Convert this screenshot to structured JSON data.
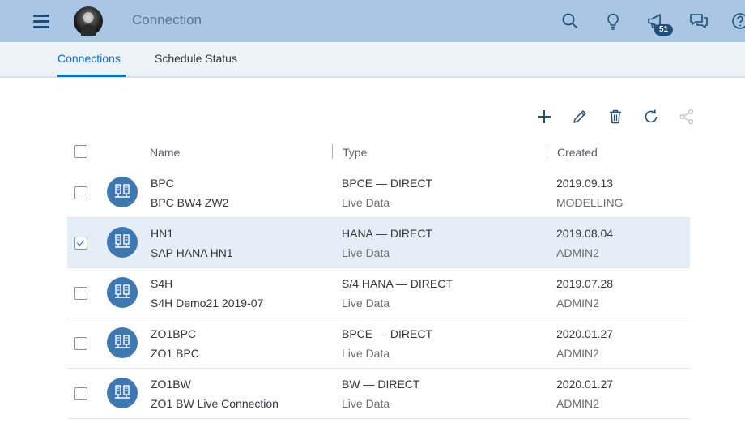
{
  "shell": {
    "title": "Connection",
    "notification_count": "51"
  },
  "tabs": [
    {
      "label": "Connections",
      "active": true
    },
    {
      "label": "Schedule Status",
      "active": false
    }
  ],
  "toolbar": {
    "actions": [
      "add-icon",
      "edit-icon",
      "delete-icon",
      "refresh-icon",
      "share-icon"
    ]
  },
  "table": {
    "headers": {
      "name": "Name",
      "type": "Type",
      "created": "Created"
    },
    "rows": [
      {
        "name": "BPC",
        "description": "BPC BW4 ZW2",
        "type": "BPCE — DIRECT",
        "data_mode": "Live Data",
        "date": "2019.09.13",
        "owner": "MODELLING",
        "selected": false
      },
      {
        "name": "HN1",
        "description": "SAP HANA HN1",
        "type": "HANA — DIRECT",
        "data_mode": "Live Data",
        "date": "2019.08.04",
        "owner": "ADMIN2",
        "selected": true
      },
      {
        "name": "S4H",
        "description": "S4H Demo21 2019-07",
        "type": "S/4 HANA — DIRECT",
        "data_mode": "Live Data",
        "date": "2019.07.28",
        "owner": "ADMIN2",
        "selected": false
      },
      {
        "name": "ZO1BPC",
        "description": "ZO1 BPC",
        "type": "BPCE — DIRECT",
        "data_mode": "Live Data",
        "date": "2020.01.27",
        "owner": "ADMIN2",
        "selected": false
      },
      {
        "name": "ZO1BW",
        "description": "ZO1 BW Live Connection",
        "type": "BW — DIRECT",
        "data_mode": "Live Data",
        "date": "2020.01.27",
        "owner": "ADMIN2",
        "selected": false
      }
    ]
  },
  "colors": {
    "shell_bg": "#a9c7e4",
    "accent": "#0a6ed1",
    "row_icon": "#3f77b0",
    "selected_row": "#e5edf6"
  }
}
